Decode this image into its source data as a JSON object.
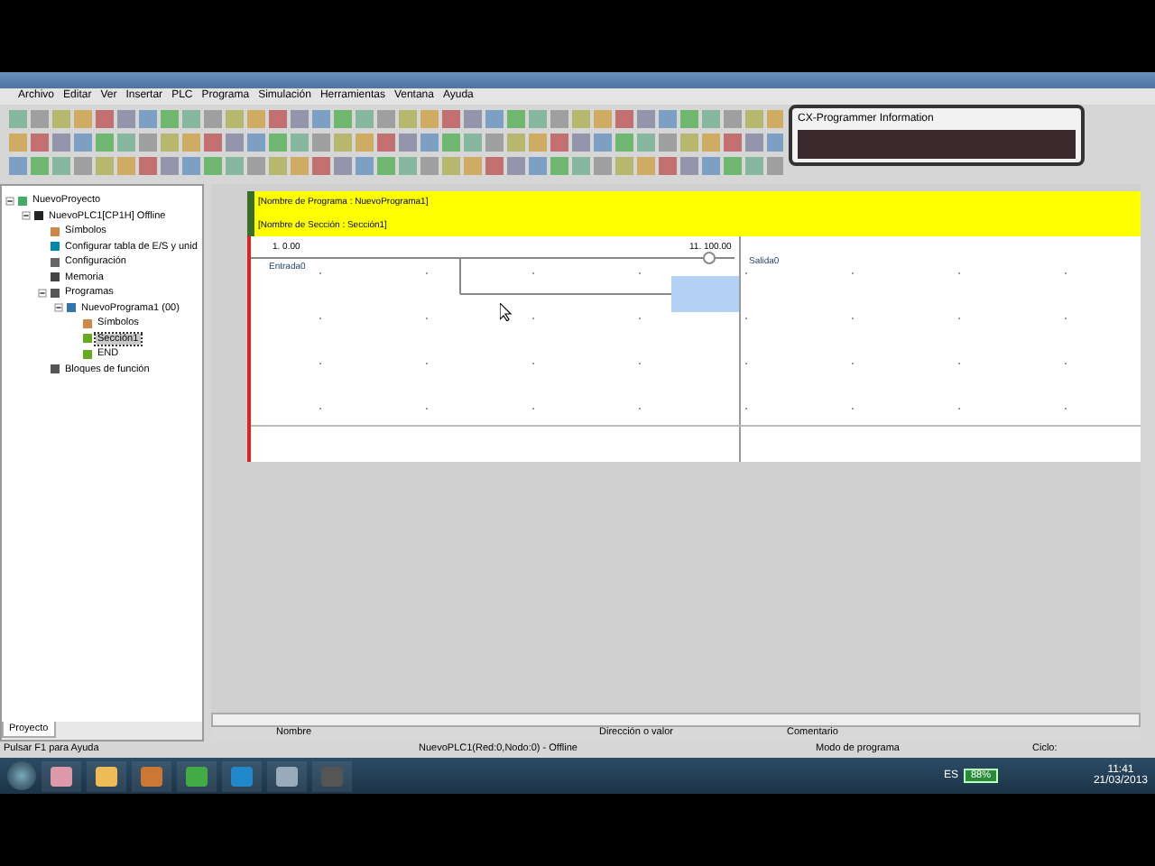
{
  "menu": [
    "Archivo",
    "Editar",
    "Ver",
    "Insertar",
    "PLC",
    "Programa",
    "Simulación",
    "Herramientas",
    "Ventana",
    "Ayuda"
  ],
  "info_panel": {
    "title": "CX-Programmer Information"
  },
  "tree": [
    {
      "label": "NuevoProyecto",
      "kind": "project",
      "expanded": true,
      "selected": false,
      "children": [
        {
          "label": "NuevoPLC1[CP1H] Offline",
          "kind": "plc",
          "expanded": true,
          "selected": false,
          "children": [
            {
              "label": "Símbolos",
              "kind": "symbols",
              "selected": false
            },
            {
              "label": "Configurar tabla de E/S y unid",
              "kind": "io",
              "selected": false
            },
            {
              "label": "Configuración",
              "kind": "settings",
              "selected": false
            },
            {
              "label": "Memoria",
              "kind": "memory",
              "selected": false
            },
            {
              "label": "Programas",
              "kind": "programs",
              "expanded": true,
              "selected": false,
              "children": [
                {
                  "label": "NuevoPrograma1 (00)",
                  "kind": "program",
                  "expanded": true,
                  "selected": false,
                  "children": [
                    {
                      "label": "Símbolos",
                      "kind": "symbols",
                      "selected": false
                    },
                    {
                      "label": "Sección1",
                      "kind": "section",
                      "selected": true
                    },
                    {
                      "label": "END",
                      "kind": "section",
                      "selected": false
                    }
                  ]
                }
              ]
            },
            {
              "label": "Bloques de función",
              "kind": "blocks",
              "selected": false
            }
          ]
        }
      ]
    }
  ],
  "panel_tab": {
    "label": "Proyecto",
    "selected": true
  },
  "ladder": {
    "program_header": "[Nombre de Programa : NuevoPrograma1]",
    "section_header": "[Nombre de Sección : Sección1]",
    "contact": {
      "address": "1. 0.00",
      "comment": "Entrada0"
    },
    "coil": {
      "address": "11. 100.00",
      "comment": "Salida0"
    }
  },
  "watch_columns": [
    "Nombre",
    "Dirección o valor",
    "Comentario"
  ],
  "status_bar": {
    "help": "Pulsar F1 para Ayuda",
    "plc": "NuevoPLC1(Red:0,Nodo:0) - Offline",
    "mode": "Modo de programa",
    "cycle": "Ciclo:"
  },
  "taskbar": {
    "language": "ES",
    "battery": "88%",
    "time": "11:41",
    "date": "21/03/2013"
  }
}
